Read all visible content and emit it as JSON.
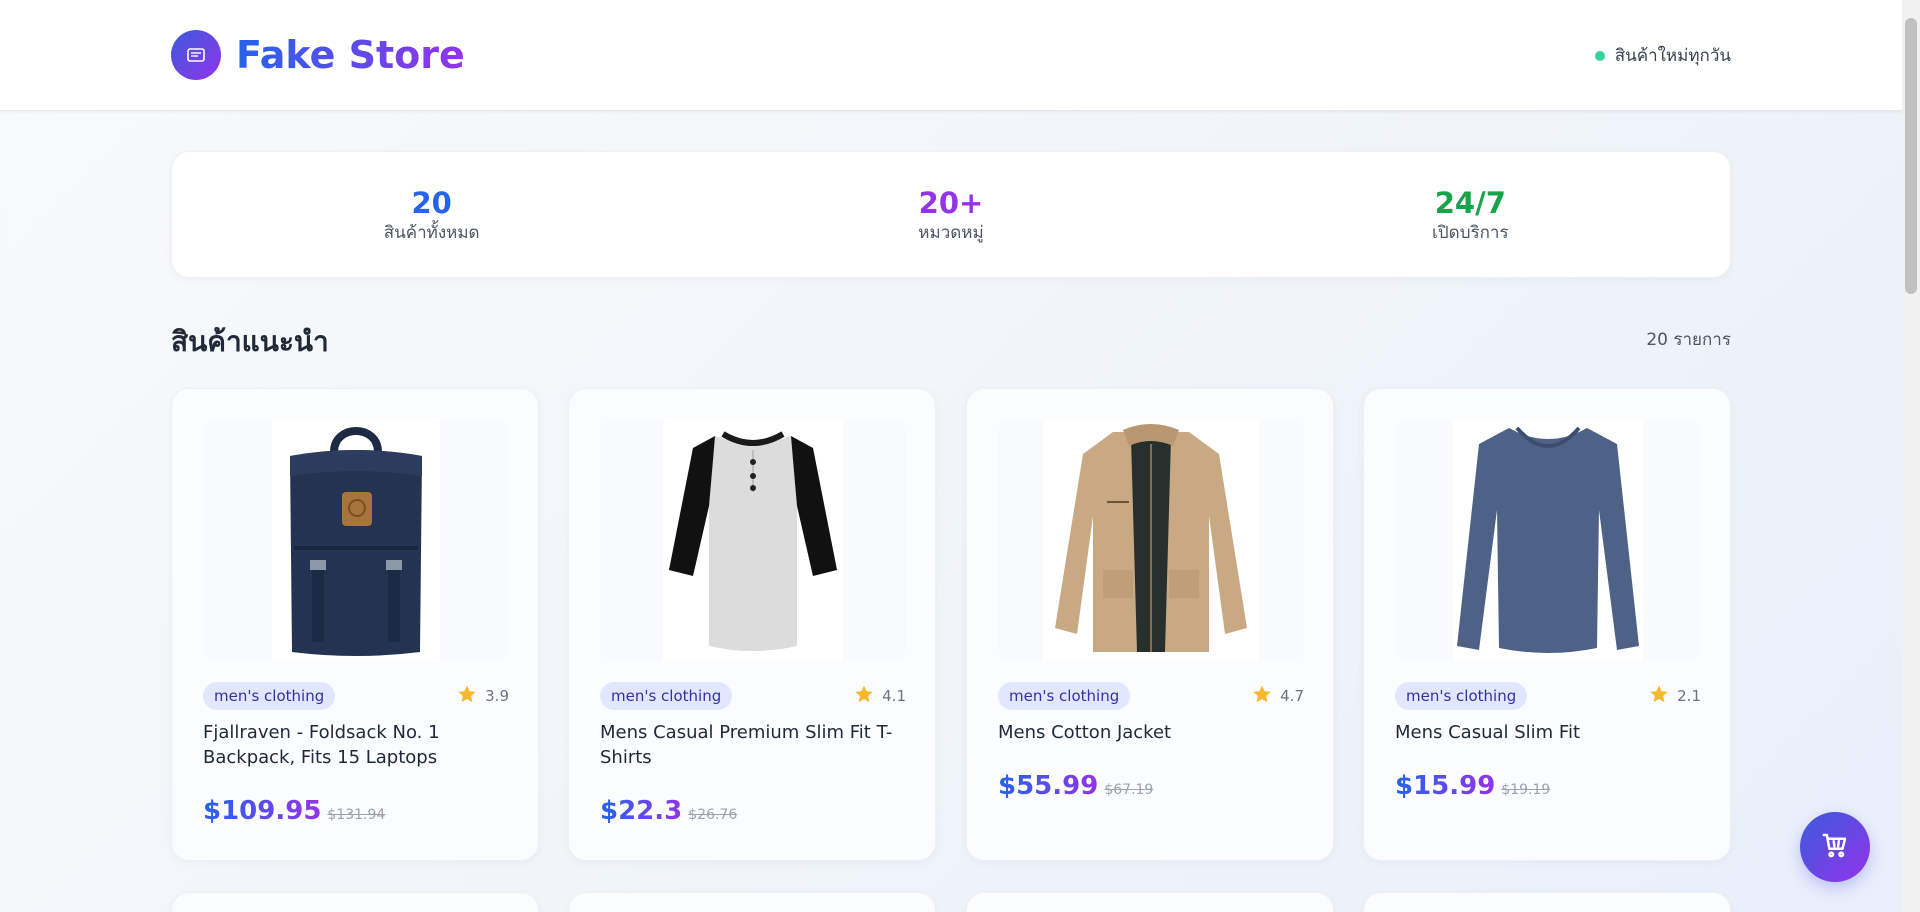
{
  "brand": {
    "name": "Fake Store"
  },
  "header": {
    "status_text": "สินค้าใหม่ทุกวัน"
  },
  "stats": [
    {
      "value": "20",
      "label": "สินค้าทั้งหมด",
      "color": "#2563eb"
    },
    {
      "value": "20+",
      "label": "หมวดหมู่",
      "color": "#9333ea"
    },
    {
      "value": "24/7",
      "label": "เปิดบริการ",
      "color": "#16a34a"
    }
  ],
  "section": {
    "title": "สินค้าแนะนำ",
    "count": "20 รายการ"
  },
  "products": [
    {
      "category": "men's clothing",
      "rating": "3.9",
      "title": "Fjallraven - Foldsack No. 1 Backpack, Fits 15 Laptops",
      "price": "$109.95",
      "old_price": "$131.94",
      "image": "backpack"
    },
    {
      "category": "men's clothing",
      "rating": "4.1",
      "title": "Mens Casual Premium Slim Fit T-Shirts",
      "price": "$22.3",
      "old_price": "$26.76",
      "image": "henley-shirt"
    },
    {
      "category": "men's clothing",
      "rating": "4.7",
      "title": "Mens Cotton Jacket",
      "price": "$55.99",
      "old_price": "$67.19",
      "image": "cotton-jacket"
    },
    {
      "category": "men's clothing",
      "rating": "2.1",
      "title": "Mens Casual Slim Fit",
      "price": "$15.99",
      "old_price": "$19.19",
      "image": "long-sleeve-shirt"
    }
  ],
  "icons": {
    "logo": "store-icon",
    "rating": "star-icon",
    "cart": "shopping-cart-icon"
  }
}
